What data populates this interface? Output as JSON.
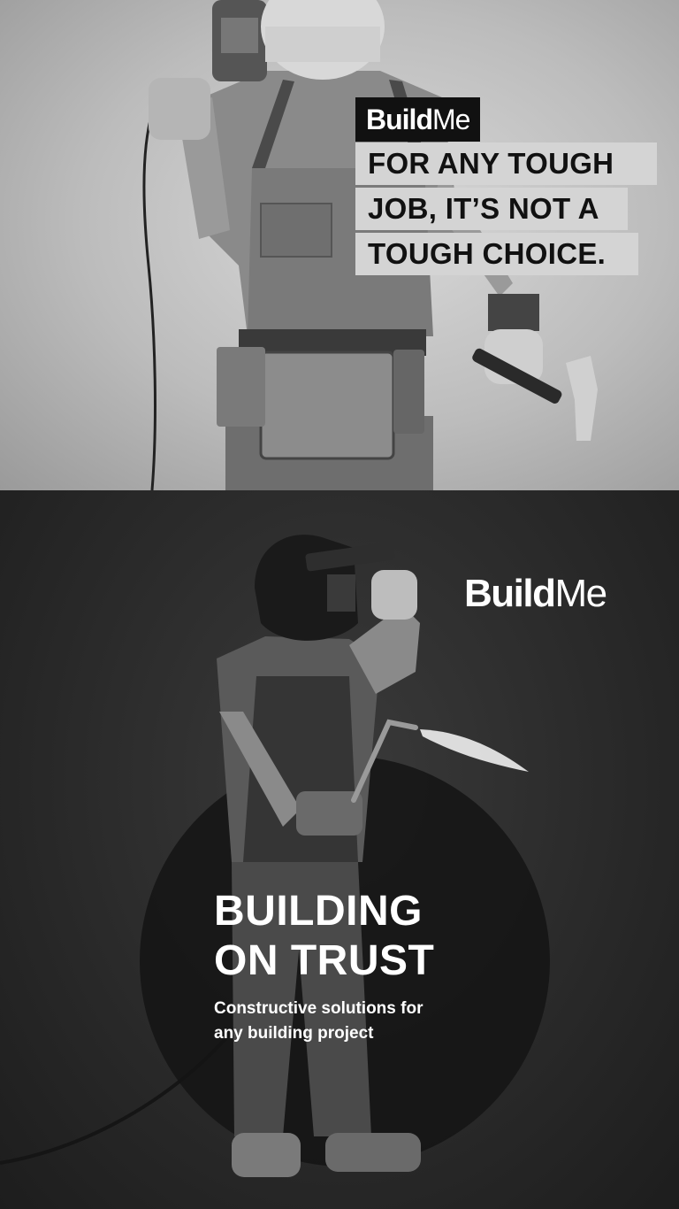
{
  "top_ad": {
    "brand": {
      "part1": "Build",
      "part2": "Me"
    },
    "tagline": [
      "FOR  ANY TOUGH",
      "JOB, IT’S NOT A",
      "TOUGH CHOICE."
    ]
  },
  "bottom_ad": {
    "brand": {
      "part1": "Build",
      "part2": "Me"
    },
    "headline": [
      "BUILDING",
      "ON TRUST"
    ],
    "subheadline": [
      "Constructive solutions for",
      "any building project"
    ]
  },
  "colors": {
    "top_background": "#c4c4c4",
    "bottom_background": "#2a2a2a",
    "logo_box": "#111111",
    "tagline_box": "#d4d4d4",
    "text_light": "#ffffff",
    "text_dark": "#111111"
  },
  "icons": [
    "hammer-icon",
    "drill-icon",
    "welding-torch-icon",
    "welding-mask-icon"
  ]
}
